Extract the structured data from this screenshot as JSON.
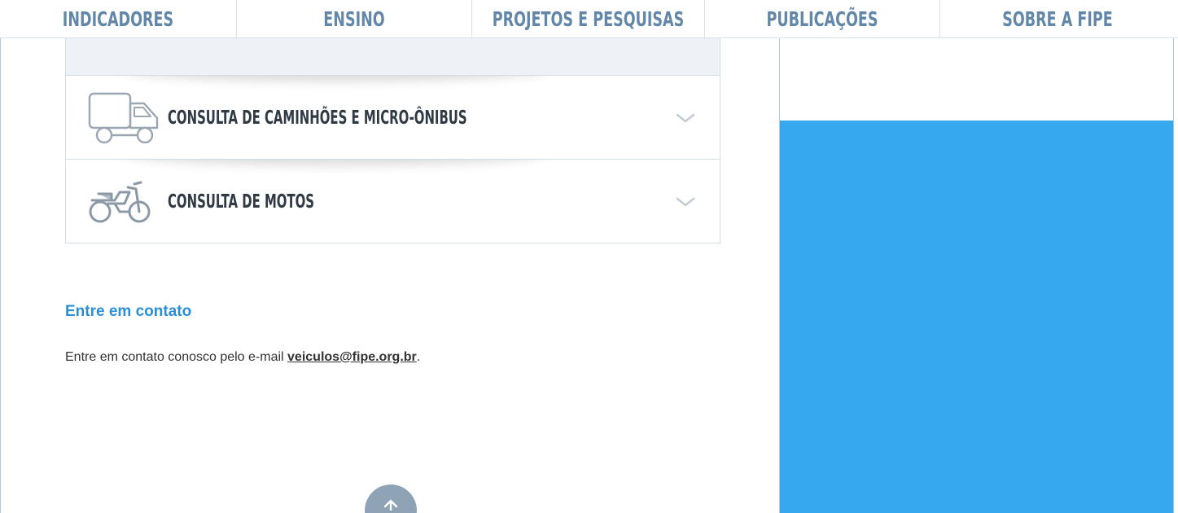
{
  "topnav": {
    "tabs": [
      {
        "label": "INDICADORES"
      },
      {
        "label": "ENSINO"
      },
      {
        "label": "PROJETOS E PESQUISAS"
      },
      {
        "label": "PUBLICAÇÕES"
      },
      {
        "label": "SOBRE A FIPE"
      }
    ]
  },
  "accordion": {
    "items": [
      {
        "label": "CONSULTA DE CAMINHÕES E MICRO-ÔNIBUS",
        "icon": "truck-icon"
      },
      {
        "label": "CONSULTA DE MOTOS",
        "icon": "motorcycle-icon"
      }
    ]
  },
  "contact": {
    "title": "Entre em contato",
    "text_prefix": "Entre em contato conosco pelo e-mail ",
    "email": "veiculos@fipe.org.br",
    "text_suffix": "."
  },
  "colors": {
    "nav_text": "#6287a8",
    "accent_link": "#2a8fd6",
    "ad_panel": "#35a8ef",
    "scroll_button": "#8fa3b7"
  },
  "icons": [
    "truck-icon",
    "motorcycle-icon",
    "chevron-down-icon",
    "arrow-up-icon"
  ]
}
